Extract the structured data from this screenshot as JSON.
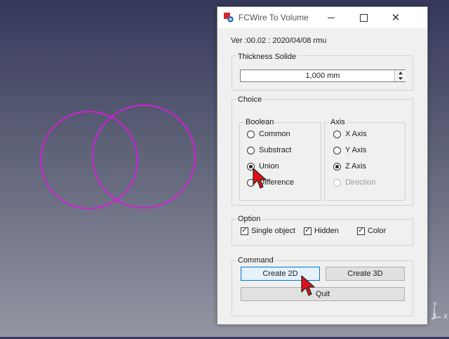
{
  "dialog": {
    "title": "FCWire To Volume",
    "version": "Ver :00.02 : 2020/04/08 rmu",
    "thickness": {
      "title": "Thickness Solide",
      "value": "1,000 mm"
    },
    "choice": {
      "title": "Choice",
      "boolean": {
        "title": "Boolean",
        "options": [
          {
            "label": "Common",
            "checked": false
          },
          {
            "label": "Substract",
            "checked": false
          },
          {
            "label": "Union",
            "checked": true
          },
          {
            "label": "Difference",
            "checked": false
          }
        ]
      },
      "axis": {
        "title": "Axis",
        "options": [
          {
            "label": "X Axis",
            "checked": false,
            "enabled": true
          },
          {
            "label": "Y Axis",
            "checked": false,
            "enabled": true
          },
          {
            "label": "Z Axis",
            "checked": true,
            "enabled": true
          },
          {
            "label": "Direction",
            "checked": false,
            "enabled": false
          }
        ]
      }
    },
    "option": {
      "title": "Option",
      "checkboxes": [
        {
          "label": "Single object",
          "checked": true
        },
        {
          "label": "Hidden",
          "checked": true
        },
        {
          "label": "Color",
          "checked": true
        }
      ]
    },
    "command": {
      "title": "Command",
      "create_2d": "Create 2D",
      "create_3d": "Create 3D",
      "quit": "Quit"
    }
  },
  "viewport": {
    "axis_labels": {
      "y": "Y",
      "z": "Z",
      "x": "X"
    },
    "circle_color": "#d21fd6"
  },
  "colors": {
    "default_button_border": "#0078d7",
    "cursor": "#e0101a"
  }
}
